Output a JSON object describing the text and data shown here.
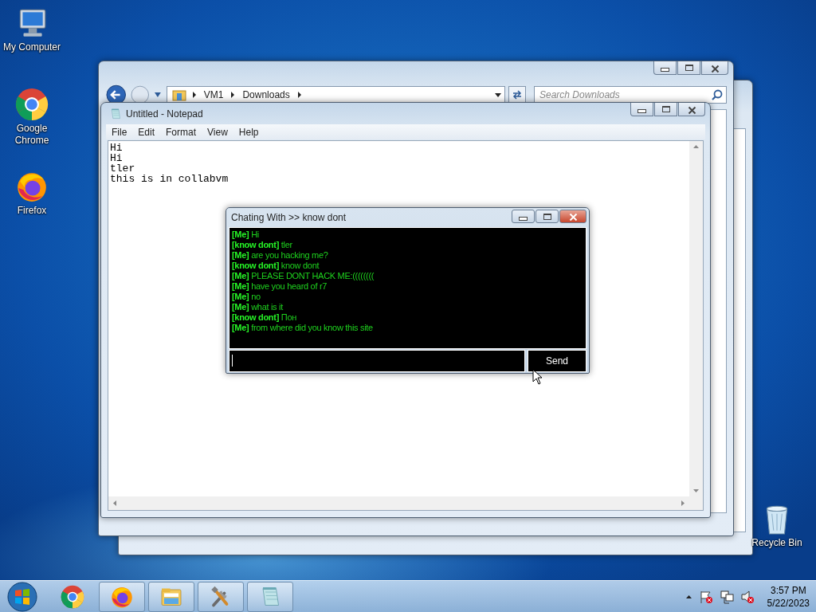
{
  "desktop_icons": [
    {
      "label": "My Computer",
      "kind": "computer"
    },
    {
      "label": "Google Chrome",
      "kind": "chrome"
    },
    {
      "label": "Firefox",
      "kind": "firefox"
    },
    {
      "label": "Recycle Bin",
      "kind": "recycle"
    }
  ],
  "explorer": {
    "path": [
      "VM1",
      "Downloads"
    ],
    "search": {
      "placeholder": "Search Downloads"
    }
  },
  "notepad": {
    "title": "Untitled - Notepad",
    "menu": [
      "File",
      "Edit",
      "Format",
      "View",
      "Help"
    ],
    "lines": [
      "Hi",
      "Hi",
      "tler",
      "this is in collabvm"
    ]
  },
  "chat": {
    "title": "Chating With >> know dont",
    "messages": [
      {
        "sender": "[Me]",
        "text": "Hi"
      },
      {
        "sender": "[know dont]",
        "text": "tler"
      },
      {
        "sender": "[Me]",
        "text": "are you hacking me?"
      },
      {
        "sender": "[know dont]",
        "text": "know dont"
      },
      {
        "sender": "[Me]",
        "text": "PLEASE DONT HACK ME:(((((((("
      },
      {
        "sender": "[Me]",
        "text": "have you heard of r7"
      },
      {
        "sender": "[Me]",
        "text": "no"
      },
      {
        "sender": "[Me]",
        "text": "what is it"
      },
      {
        "sender": "[know dont]",
        "text": "Пон"
      },
      {
        "sender": "[Me]",
        "text": "from where did you know this site"
      }
    ],
    "send_button": "Send"
  },
  "taskbar": {
    "buttons": [
      {
        "kind": "chrome",
        "running": false
      },
      {
        "kind": "firefox",
        "running": true
      },
      {
        "kind": "explorer",
        "running": true
      },
      {
        "kind": "tools",
        "running": true
      },
      {
        "kind": "notepad",
        "running": true
      }
    ],
    "clock": {
      "time": "3:57 PM",
      "date": "5/22/2023"
    }
  }
}
